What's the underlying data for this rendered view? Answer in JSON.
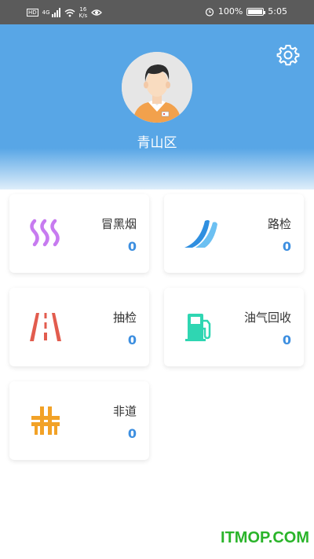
{
  "status_bar": {
    "network": "4G",
    "speed_value": "16",
    "speed_unit": "K/s",
    "battery": "100%",
    "time": "5:05"
  },
  "header": {
    "district": "青山区",
    "settings_icon": "gear-icon",
    "avatar_icon": "user-avatar"
  },
  "cards": [
    {
      "label": "冒黑烟",
      "count": "0",
      "icon": "smoke-icon",
      "color": "#c77bf0"
    },
    {
      "label": "路检",
      "count": "0",
      "icon": "road-check-icon",
      "color": "#3e9ee8"
    },
    {
      "label": "抽检",
      "count": "0",
      "icon": "road-lane-icon",
      "color": "#e25c4e"
    },
    {
      "label": "油气回收",
      "count": "0",
      "icon": "fuel-pump-icon",
      "color": "#2fd6b2"
    },
    {
      "label": "非道",
      "count": "0",
      "icon": "off-road-icon",
      "color": "#f2a227"
    }
  ],
  "watermark": "ITMOP.COM",
  "colors": {
    "header_blue": "#58a6e6",
    "count_blue": "#3d8fe0"
  }
}
